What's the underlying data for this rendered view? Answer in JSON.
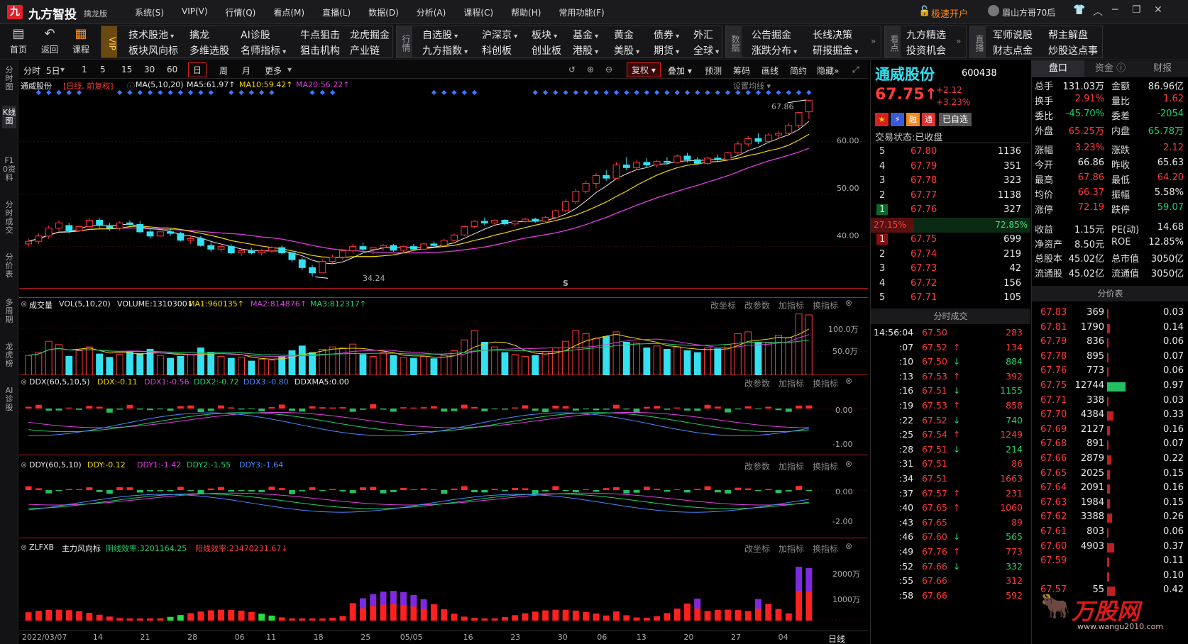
{
  "app": {
    "name": "九方智投",
    "edition": "擒龙版",
    "open_account": "极速开户",
    "user": "眉山方哥70后"
  },
  "menu": [
    "系统(S)",
    "VIP(V)",
    "行情(Q)",
    "看点(M)",
    "直播(L)",
    "数据(D)",
    "分析(A)",
    "课程(C)",
    "帮助(H)",
    "常用功能(F)"
  ],
  "toolbar": {
    "home": "首页",
    "back": "返回",
    "course": "课程",
    "g1": [
      "技术股池",
      "擒龙",
      "AI诊股",
      "牛点狙击",
      "龙虎掘金",
      "板块风向标",
      "多维选股",
      "名师指标",
      "狙击机构",
      "产业链"
    ],
    "g2_label": "行情",
    "g2": [
      "自选股",
      "沪深京",
      "板块",
      "基金",
      "黄金",
      "债券",
      "外汇",
      "九方指数",
      "科创板",
      "创业板",
      "港股",
      "美股",
      "期货",
      "全球"
    ],
    "g3_label": "数据",
    "g3": [
      "公告掘金",
      "长线决策",
      "涨跌分布",
      "研报掘金"
    ],
    "g4_label": "看点",
    "g4": [
      "九方精选",
      "投资机会"
    ],
    "g5_label": "直播",
    "g5": [
      "军师说股",
      "帮主解盘",
      "财志点金",
      "炒股这点事"
    ]
  },
  "leftbar": [
    "分时图",
    "K线图",
    "F10资料",
    "分时成交",
    "分价表",
    "多周期",
    "龙虎榜",
    "AI诊股"
  ],
  "chart_toolbar": {
    "items": [
      "分时",
      "5日",
      "1",
      "5",
      "15",
      "30",
      "60",
      "日",
      "周",
      "月",
      "更多"
    ],
    "active": "日",
    "right": [
      "复权",
      "叠加",
      "预测",
      "筹码",
      "画线",
      "简约",
      "隐藏"
    ]
  },
  "kline": {
    "label": "通威股份",
    "period": "[日线, 前复权]",
    "ma_label": "MA(5,10,20)",
    "ma5": "MA5:61.97↑",
    "ma10": "MA10:59.42↑",
    "ma20": "MA20:56.22↑",
    "setting": "设置均线",
    "high_mark": "67.86",
    "low_mark": "34.24",
    "s_mark": "S",
    "y_ticks": [
      "60.00",
      "50.00",
      "40.00"
    ]
  },
  "volume": {
    "label": "成交量",
    "params": "VOL(5,10,20)",
    "volume": "VOLUME:1310300↓",
    "ma1": "MA1:960135↑",
    "ma2": "MA2:814876↑",
    "ma3": "MA3:812317↑",
    "buttons": [
      "改坐标",
      "改参数",
      "加指标",
      "换指标"
    ],
    "y_ticks": [
      "100.0万",
      "50.0万"
    ]
  },
  "ddx": {
    "label": "DDX(60,5,10,5)",
    "v": "DDX:-0.11",
    "v1": "DDX1:-0.56",
    "v2": "DDX2:-0.72",
    "v3": "DDX3:-0.80",
    "ma": "DDXMA5:0.00",
    "buttons": [
      "改参数",
      "加指标",
      "换指标"
    ],
    "y_ticks": [
      "0.00",
      "-1.00"
    ]
  },
  "ddy": {
    "label": "DDY(60,5,10)",
    "v": "DDY:-0.12",
    "v1": "DDY1:-1.42",
    "v2": "DDY2:-1.55",
    "v3": "DDY3:-1.64",
    "buttons": [
      "改参数",
      "加指标",
      "换指标"
    ],
    "y_ticks": [
      "0.00",
      "-2.00"
    ]
  },
  "zlfxb": {
    "label": "ZLFXB",
    "name": "主力风向标",
    "neg": "阴线效率:3201164.25",
    "pos": "阳线效率:23470231.67↓",
    "buttons": [
      "改坐标",
      "加指标",
      "换指标"
    ],
    "y_ticks": [
      "2000万",
      "1000万"
    ]
  },
  "dates": [
    "2022/03/07",
    "14",
    "21",
    "28",
    "06",
    "11",
    "18",
    "25",
    "05/05",
    "16",
    "23",
    "30",
    "06",
    "13",
    "20",
    "27",
    "04"
  ],
  "date_axis_label": "日线",
  "quote": {
    "name": "通威股份",
    "code": "600438",
    "price": "67.75",
    "arrow": "↑",
    "change": "+2.12",
    "pct": "+3.23%",
    "self_selected": "已自选",
    "status_label": "交易状态:",
    "status": "已收盘",
    "asks": [
      [
        "5",
        "67.80",
        "1136"
      ],
      [
        "4",
        "67.79",
        "351"
      ],
      [
        "3",
        "67.78",
        "323"
      ],
      [
        "2",
        "67.77",
        "1138"
      ],
      [
        "1",
        "67.76",
        "327"
      ]
    ],
    "bid_pct": "27.15%",
    "ask_pct": "72.85%",
    "bids": [
      [
        "1",
        "67.75",
        "699"
      ],
      [
        "2",
        "67.74",
        "219"
      ],
      [
        "3",
        "67.73",
        "42"
      ],
      [
        "4",
        "67.72",
        "156"
      ],
      [
        "5",
        "67.71",
        "105"
      ]
    ],
    "ticks_title": "分时成交",
    "ticks": [
      [
        "14:56:04",
        "67.50",
        "283",
        ""
      ],
      [
        ":07",
        "67.52",
        "134",
        "↑"
      ],
      [
        ":10",
        "67.50",
        "884",
        "↓"
      ],
      [
        ":13",
        "67.53",
        "392",
        "↑"
      ],
      [
        ":16",
        "67.51",
        "1155",
        "↓"
      ],
      [
        ":19",
        "67.53",
        "858",
        "↑"
      ],
      [
        ":22",
        "67.52",
        "740",
        "↓"
      ],
      [
        ":25",
        "67.54",
        "1249",
        "↑"
      ],
      [
        ":28",
        "67.51",
        "214",
        "↓"
      ],
      [
        ":31",
        "67.51",
        "86",
        ""
      ],
      [
        ":34",
        "67.51",
        "1663",
        ""
      ],
      [
        ":37",
        "67.57",
        "231",
        "↑"
      ],
      [
        ":40",
        "67.65",
        "1060",
        "↑"
      ],
      [
        ":43",
        "67.65",
        "89",
        ""
      ],
      [
        ":46",
        "67.60",
        "565",
        "↓"
      ],
      [
        ":49",
        "67.76",
        "773",
        "↑"
      ],
      [
        ":52",
        "67.66",
        "332",
        "↓"
      ],
      [
        ":55",
        "67.66",
        "312",
        ""
      ],
      [
        ":58",
        "67.66",
        "592",
        ""
      ]
    ]
  },
  "stats": {
    "tabs": [
      "盘口",
      "资金",
      "财报"
    ],
    "rows": [
      [
        "总手",
        "131.03万",
        "金额",
        "86.96亿"
      ],
      [
        "换手",
        "2.91%",
        "量比",
        "1.62"
      ],
      [
        "委比",
        "-45.70%",
        "委差",
        "-2054"
      ],
      [
        "外盘",
        "65.25万",
        "内盘",
        "65.78万"
      ]
    ],
    "rows2": [
      [
        "涨幅",
        "3.23%",
        "涨跌",
        "2.12"
      ],
      [
        "今开",
        "66.86",
        "昨收",
        "65.63"
      ],
      [
        "最高",
        "67.86",
        "最低",
        "64.20"
      ],
      [
        "均价",
        "66.37",
        "振幅",
        "5.58%"
      ],
      [
        "涨停",
        "72.19",
        "跌停",
        "59.07"
      ]
    ],
    "rows3": [
      [
        "收益",
        "1.15元",
        "PE(动)",
        "14.68"
      ],
      [
        "净资产",
        "8.50元",
        "ROE",
        "12.85%"
      ],
      [
        "总股本",
        "45.02亿",
        "总市值",
        "3050亿"
      ],
      [
        "流通股",
        "45.02亿",
        "流通值",
        "3050亿"
      ]
    ],
    "fjb_title": "分价表",
    "fjb": [
      [
        "67.83",
        "369",
        "0.03",
        0.3
      ],
      [
        "67.81",
        "1790",
        "0.14",
        1.4
      ],
      [
        "67.79",
        "836",
        "0.06",
        0.6
      ],
      [
        "67.78",
        "895",
        "0.07",
        0.7
      ],
      [
        "67.76",
        "773",
        "0.06",
        0.6
      ],
      [
        "67.75",
        "12744",
        "0.97",
        10
      ],
      [
        "67.71",
        "338",
        "0.03",
        0.3
      ],
      [
        "67.70",
        "4384",
        "0.33",
        3.4
      ],
      [
        "67.69",
        "2127",
        "0.16",
        1.7
      ],
      [
        "67.68",
        "891",
        "0.07",
        0.7
      ],
      [
        "67.66",
        "2879",
        "0.22",
        2.3
      ],
      [
        "67.65",
        "2025",
        "0.15",
        1.6
      ],
      [
        "67.64",
        "2091",
        "0.16",
        1.6
      ],
      [
        "67.63",
        "1984",
        "0.15",
        1.6
      ],
      [
        "67.62",
        "3388",
        "0.26",
        2.7
      ],
      [
        "67.61",
        "803",
        "0.06",
        0.6
      ],
      [
        "67.60",
        "4903",
        "0.37",
        3.8
      ],
      [
        "67.59",
        "",
        "0.11",
        1.1
      ],
      [
        "",
        "",
        "0.10",
        1
      ],
      [
        "67.57",
        "55",
        "0.42",
        4.2
      ]
    ],
    "watermark": "万股网",
    "watermark_url": "www.wangu2010.com"
  },
  "chart_data": {
    "type": "candlestick",
    "series_note": "",
    "ohlc": [
      [
        40.5,
        41.5,
        40,
        41
      ],
      [
        41,
        42.5,
        40.5,
        42
      ],
      [
        42,
        44,
        41.5,
        43.5
      ],
      [
        43.5,
        45,
        43,
        44.5
      ],
      [
        44,
        44.5,
        42.5,
        43
      ],
      [
        43,
        44,
        42.8,
        43.8
      ],
      [
        43.8,
        45.5,
        43.5,
        45
      ],
      [
        45,
        45.5,
        43.5,
        44
      ],
      [
        44,
        44.5,
        43,
        43.5
      ],
      [
        43.5,
        44.8,
        43,
        44.5
      ],
      [
        44.5,
        45,
        43.8,
        44.2
      ],
      [
        44.2,
        44.8,
        42.5,
        42.8
      ],
      [
        42.8,
        43.5,
        41.5,
        42
      ],
      [
        42,
        43,
        41.8,
        42.8
      ],
      [
        42.8,
        43.5,
        42,
        42.5
      ],
      [
        42.5,
        42.8,
        41,
        41.2
      ],
      [
        41.2,
        42,
        40.5,
        41.5
      ],
      [
        41.5,
        42,
        40,
        40.2
      ],
      [
        40.2,
        40.8,
        39,
        39.5
      ],
      [
        39.5,
        40.5,
        39,
        40
      ],
      [
        40,
        40.5,
        38.5,
        38.8
      ],
      [
        38.8,
        39.5,
        38.2,
        39.2
      ],
      [
        39.2,
        39.8,
        38.5,
        38.8
      ],
      [
        38.8,
        39.5,
        38.3,
        39.2
      ],
      [
        39.2,
        40,
        38.8,
        39.8
      ],
      [
        39.8,
        40.2,
        38.5,
        38.8
      ],
      [
        38.8,
        39,
        37,
        37.5
      ],
      [
        37.5,
        38,
        35.5,
        36
      ],
      [
        36,
        36.5,
        34.24,
        35
      ],
      [
        35,
        37.5,
        35,
        37.2
      ],
      [
        37.2,
        38.5,
        36.8,
        38
      ],
      [
        38,
        39.5,
        37.5,
        39.2
      ],
      [
        39.2,
        40.5,
        38.8,
        40
      ],
      [
        40,
        40.8,
        39,
        39.5
      ],
      [
        39.5,
        40,
        38.5,
        39.8
      ],
      [
        39.8,
        40.5,
        39.2,
        40.2
      ],
      [
        40.2,
        40.5,
        39,
        39.3
      ],
      [
        39.3,
        40.2,
        39,
        40
      ],
      [
        40,
        40.5,
        39.2,
        39.5
      ],
      [
        39.5,
        40.8,
        39.3,
        40.5
      ],
      [
        40.5,
        41,
        39.8,
        40.2
      ],
      [
        40.2,
        41.5,
        40,
        41.2
      ],
      [
        41.2,
        42.5,
        41,
        42.2
      ],
      [
        42.2,
        44,
        42,
        43.8
      ],
      [
        43.8,
        45,
        43.5,
        44.8
      ],
      [
        44.8,
        45.5,
        44,
        44.5
      ],
      [
        44.5,
        45.2,
        44,
        45
      ],
      [
        45,
        45.2,
        44,
        44.3
      ],
      [
        44.3,
        45,
        43.8,
        44.8
      ],
      [
        44.8,
        45.5,
        44.5,
        45.2
      ],
      [
        45.2,
        45.5,
        44.5,
        44.8
      ],
      [
        44.8,
        45.8,
        44.5,
        45.5
      ],
      [
        45.5,
        47,
        45.2,
        46.8
      ],
      [
        46.8,
        49,
        46.5,
        48.5
      ],
      [
        48.5,
        51,
        48,
        50.5
      ],
      [
        50.5,
        52.5,
        50,
        52
      ],
      [
        52,
        54,
        51,
        53.5
      ],
      [
        53.5,
        54.5,
        52.5,
        53
      ],
      [
        53,
        56,
        52.8,
        55.5
      ],
      [
        55.5,
        57,
        54.5,
        55
      ],
      [
        55,
        56.5,
        54.5,
        56
      ],
      [
        56,
        56.8,
        55,
        55.5
      ],
      [
        55.5,
        56.5,
        55,
        56.2
      ],
      [
        56.2,
        57,
        55.5,
        56
      ],
      [
        56,
        57.5,
        55.8,
        57.2
      ],
      [
        57.2,
        57.8,
        56,
        56.5
      ],
      [
        56.5,
        57,
        55.5,
        55.8
      ],
      [
        55.8,
        57,
        55.5,
        56.8
      ],
      [
        56.8,
        57.5,
        56,
        56.5
      ],
      [
        56.5,
        58,
        56.3,
        57.8
      ],
      [
        57.8,
        60,
        57.5,
        59.5
      ],
      [
        59.5,
        61,
        59,
        60.5
      ],
      [
        60.5,
        61.5,
        59.5,
        60
      ],
      [
        60,
        61.5,
        59.8,
        61.2
      ],
      [
        61.2,
        62,
        60.5,
        61.5
      ],
      [
        61.5,
        63.5,
        61.2,
        63
      ],
      [
        63,
        65,
        62.5,
        65.5
      ],
      [
        65.6,
        67.86,
        64.2,
        67.75
      ]
    ],
    "volume": [
      42,
      48,
      72,
      65,
      40,
      52,
      60,
      45,
      38,
      44,
      50,
      46,
      55,
      42,
      36,
      40,
      44,
      58,
      48,
      40,
      36,
      38,
      30,
      34,
      32,
      40,
      52,
      62,
      48,
      55,
      60,
      58,
      66,
      44,
      40,
      48,
      42,
      38,
      36,
      40,
      35,
      42,
      52,
      75,
      95,
      70,
      60,
      48,
      44,
      40,
      42,
      50,
      58,
      72,
      95,
      88,
      78,
      82,
      92,
      70,
      68,
      58,
      62,
      55,
      60,
      52,
      48,
      58,
      56,
      65,
      88,
      92,
      70,
      68,
      85,
      80,
      130,
      128
    ],
    "y_range": [
      32,
      70
    ],
    "vol_range": [
      0,
      140
    ]
  }
}
